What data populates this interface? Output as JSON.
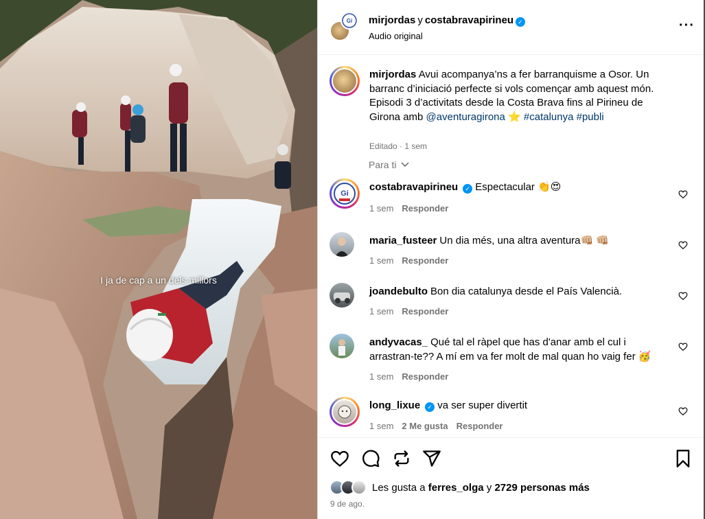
{
  "media": {
    "overlay_text": "I ja de cap a un dels millors"
  },
  "header": {
    "user1": "mirjordas",
    "conjunction": "y",
    "user2": "costabravapirineu",
    "audio": "Audio original",
    "more_icon": "more-horizontal-icon"
  },
  "caption": {
    "username": "mirjordas",
    "text_before": "Avui acompanya’ns a fer barranquisme a Osor. Un barranc d’iniciació perfecte si vols començar amb aquest món. Episodi 3 d’activitats desde la Costa Brava fins al Pirineu de Girona amb",
    "mention": "@aventuragirona",
    "emoji": "⭐",
    "hashtag1": "#catalunya",
    "hashtag2": "#publi",
    "edited": "Editado · 1 sem"
  },
  "sort_label": "Para ti",
  "comments": [
    {
      "username": "costabravapirineu",
      "text": "Espectacular 👏😍",
      "time": "1 sem",
      "reply": "Responder"
    },
    {
      "username": "maria_fusteer",
      "text": "Un dia més, una altra aventura👊🏼 👊🏼",
      "time": "1 sem",
      "reply": "Responder"
    },
    {
      "username": "joandebulto",
      "text": "Bon dia catalunya desde el País Valencià.",
      "time": "1 sem",
      "reply": "Responder"
    },
    {
      "username": "andyvacas_",
      "text": "Qué tal el ràpel que has d'anar amb el cul i arrastran-te?? A mí em va fer molt de mal quan ho vaig fer 🥳",
      "time": "1 sem",
      "reply": "Responder"
    },
    {
      "username": "long_lixue",
      "text": "va ser super divertit",
      "time": "1 sem",
      "likes": "2 Me gusta",
      "reply": "Responder"
    }
  ],
  "likes": {
    "prefix": "Les gusta a",
    "user": "ferres_olga",
    "conj": "y",
    "count": "2729 personas más"
  },
  "date": "9 de ago."
}
